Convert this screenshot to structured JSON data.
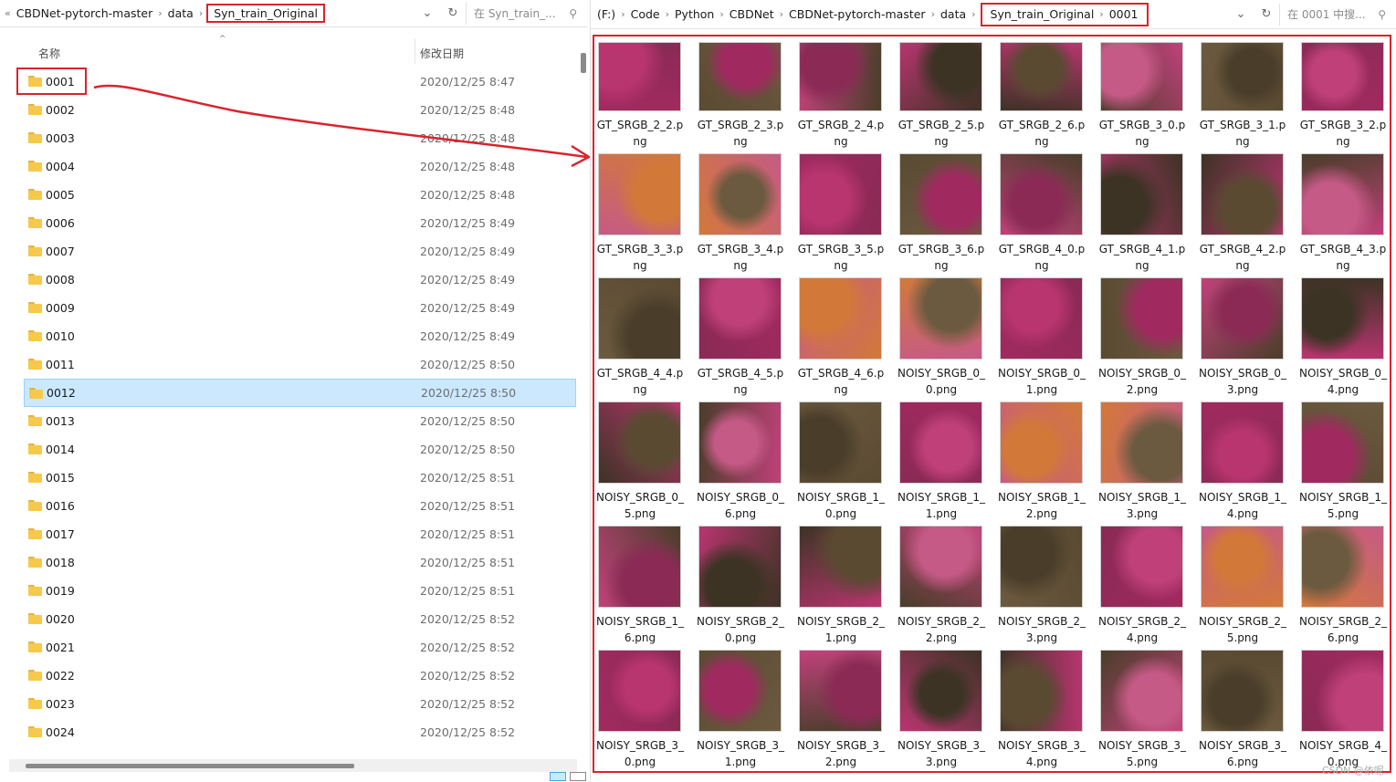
{
  "left": {
    "breadcrumb": [
      "CBDNet-pytorch-master",
      "data",
      "Syn_train_Original"
    ],
    "search_placeholder": "在 Syn_train_...",
    "col_name": "名称",
    "col_date": "修改日期",
    "rows": [
      {
        "name": "0001",
        "date": "2020/12/25 8:47"
      },
      {
        "name": "0002",
        "date": "2020/12/25 8:48"
      },
      {
        "name": "0003",
        "date": "2020/12/25 8:48"
      },
      {
        "name": "0004",
        "date": "2020/12/25 8:48"
      },
      {
        "name": "0005",
        "date": "2020/12/25 8:48"
      },
      {
        "name": "0006",
        "date": "2020/12/25 8:49"
      },
      {
        "name": "0007",
        "date": "2020/12/25 8:49"
      },
      {
        "name": "0008",
        "date": "2020/12/25 8:49"
      },
      {
        "name": "0009",
        "date": "2020/12/25 8:49"
      },
      {
        "name": "0010",
        "date": "2020/12/25 8:49"
      },
      {
        "name": "0011",
        "date": "2020/12/25 8:50"
      },
      {
        "name": "0012",
        "date": "2020/12/25 8:50"
      },
      {
        "name": "0013",
        "date": "2020/12/25 8:50"
      },
      {
        "name": "0014",
        "date": "2020/12/25 8:50"
      },
      {
        "name": "0015",
        "date": "2020/12/25 8:51"
      },
      {
        "name": "0016",
        "date": "2020/12/25 8:51"
      },
      {
        "name": "0017",
        "date": "2020/12/25 8:51"
      },
      {
        "name": "0018",
        "date": "2020/12/25 8:51"
      },
      {
        "name": "0019",
        "date": "2020/12/25 8:51"
      },
      {
        "name": "0020",
        "date": "2020/12/25 8:52"
      },
      {
        "name": "0021",
        "date": "2020/12/25 8:52"
      },
      {
        "name": "0022",
        "date": "2020/12/25 8:52"
      },
      {
        "name": "0023",
        "date": "2020/12/25 8:52"
      },
      {
        "name": "0024",
        "date": "2020/12/25 8:52"
      }
    ],
    "selected_row": "0012",
    "highlighted_row": "0001"
  },
  "right": {
    "breadcrumb_prefix": [
      "(F:)",
      "Code",
      "Python",
      "CBDNet",
      "CBDNet-pytorch-master",
      "data"
    ],
    "breadcrumb_highlight": [
      "Syn_train_Original",
      "0001"
    ],
    "search_placeholder": "在 0001 中搜...",
    "files": [
      "GT_SRGB_2_2.png",
      "GT_SRGB_2_3.png",
      "GT_SRGB_2_4.png",
      "GT_SRGB_2_5.png",
      "GT_SRGB_2_6.png",
      "GT_SRGB_3_0.png",
      "GT_SRGB_3_1.png",
      "GT_SRGB_3_2.png",
      "GT_SRGB_3_3.png",
      "GT_SRGB_3_4.png",
      "GT_SRGB_3_5.png",
      "GT_SRGB_3_6.png",
      "GT_SRGB_4_0.png",
      "GT_SRGB_4_1.png",
      "GT_SRGB_4_2.png",
      "GT_SRGB_4_3.png",
      "GT_SRGB_4_4.png",
      "GT_SRGB_4_5.png",
      "GT_SRGB_4_6.png",
      "NOISY_SRGB_0_0.png",
      "NOISY_SRGB_0_1.png",
      "NOISY_SRGB_0_2.png",
      "NOISY_SRGB_0_3.png",
      "NOISY_SRGB_0_4.png",
      "NOISY_SRGB_0_5.png",
      "NOISY_SRGB_0_6.png",
      "NOISY_SRGB_1_0.png",
      "NOISY_SRGB_1_1.png",
      "NOISY_SRGB_1_2.png",
      "NOISY_SRGB_1_3.png",
      "NOISY_SRGB_1_4.png",
      "NOISY_SRGB_1_5.png",
      "NOISY_SRGB_1_6.png",
      "NOISY_SRGB_2_0.png",
      "NOISY_SRGB_2_1.png",
      "NOISY_SRGB_2_2.png",
      "NOISY_SRGB_2_3.png",
      "NOISY_SRGB_2_4.png",
      "NOISY_SRGB_2_5.png",
      "NOISY_SRGB_2_6.png",
      "NOISY_SRGB_3_0.png",
      "NOISY_SRGB_3_1.png",
      "NOISY_SRGB_3_2.png",
      "NOISY_SRGB_3_3.png",
      "NOISY_SRGB_3_4.png",
      "NOISY_SRGB_3_5.png",
      "NOISY_SRGB_3_6.png",
      "NOISY_SRGB_4_0.png"
    ],
    "captions": [
      [
        "GT_SRGB_2_2.p",
        "ng"
      ],
      [
        "GT_SRGB_2_3.p",
        "ng"
      ],
      [
        "GT_SRGB_2_4.p",
        "ng"
      ],
      [
        "GT_SRGB_2_5.p",
        "ng"
      ],
      [
        "GT_SRGB_2_6.p",
        "ng"
      ],
      [
        "GT_SRGB_3_0.p",
        "ng"
      ],
      [
        "GT_SRGB_3_1.p",
        "ng"
      ],
      [
        "GT_SRGB_3_2.p",
        "ng"
      ],
      [
        "GT_SRGB_3_3.p",
        "ng"
      ],
      [
        "GT_SRGB_3_4.p",
        "ng"
      ],
      [
        "GT_SRGB_3_5.p",
        "ng"
      ],
      [
        "GT_SRGB_3_6.p",
        "ng"
      ],
      [
        "GT_SRGB_4_0.p",
        "ng"
      ],
      [
        "GT_SRGB_4_1.p",
        "ng"
      ],
      [
        "GT_SRGB_4_2.p",
        "ng"
      ],
      [
        "GT_SRGB_4_3.p",
        "ng"
      ],
      [
        "GT_SRGB_4_4.p",
        "ng"
      ],
      [
        "GT_SRGB_4_5.p",
        "ng"
      ],
      [
        "GT_SRGB_4_6.p",
        "ng"
      ],
      [
        "NOISY_SRGB_0_",
        "0.png"
      ],
      [
        "NOISY_SRGB_0_",
        "1.png"
      ],
      [
        "NOISY_SRGB_0_",
        "2.png"
      ],
      [
        "NOISY_SRGB_0_",
        "3.png"
      ],
      [
        "NOISY_SRGB_0_",
        "4.png"
      ],
      [
        "NOISY_SRGB_0_",
        "5.png"
      ],
      [
        "NOISY_SRGB_0_",
        "6.png"
      ],
      [
        "NOISY_SRGB_1_",
        "0.png"
      ],
      [
        "NOISY_SRGB_1_",
        "1.png"
      ],
      [
        "NOISY_SRGB_1_",
        "2.png"
      ],
      [
        "NOISY_SRGB_1_",
        "3.png"
      ],
      [
        "NOISY_SRGB_1_",
        "4.png"
      ],
      [
        "NOISY_SRGB_1_",
        "5.png"
      ],
      [
        "NOISY_SRGB_1_",
        "6.png"
      ],
      [
        "NOISY_SRGB_2_",
        "0.png"
      ],
      [
        "NOISY_SRGB_2_",
        "1.png"
      ],
      [
        "NOISY_SRGB_2_",
        "2.png"
      ],
      [
        "NOISY_SRGB_2_",
        "3.png"
      ],
      [
        "NOISY_SRGB_2_",
        "4.png"
      ],
      [
        "NOISY_SRGB_2_",
        "5.png"
      ],
      [
        "NOISY_SRGB_2_",
        "6.png"
      ],
      [
        "NOISY_SRGB_3_",
        "0.png"
      ],
      [
        "NOISY_SRGB_3_",
        "1.png"
      ],
      [
        "NOISY_SRGB_3_",
        "2.png"
      ],
      [
        "NOISY_SRGB_3_",
        "3.png"
      ],
      [
        "NOISY_SRGB_3_",
        "4.png"
      ],
      [
        "NOISY_SRGB_3_",
        "5.png"
      ],
      [
        "NOISY_SRGB_3_",
        "6.png"
      ],
      [
        "NOISY_SRGB_4_",
        "0.png"
      ]
    ],
    "thumb_palette": [
      "#b8356f",
      "#a02a5f",
      "#8a2a55",
      "#3d3325",
      "#5a4a32",
      "#c65a86",
      "#4a3e2a",
      "#c0417a",
      "#d2793a",
      "#6b5a3f"
    ]
  },
  "watermark": "CSDN @依呢",
  "colors": {
    "highlight_red": "#d9232e",
    "selection_blue": "#cce8ff",
    "folder_yellow": "#f6c94b"
  },
  "icons": [
    "chevron-right-icon",
    "chevron-down-icon",
    "refresh-icon",
    "search-icon",
    "folder-icon",
    "sort-up-icon"
  ]
}
